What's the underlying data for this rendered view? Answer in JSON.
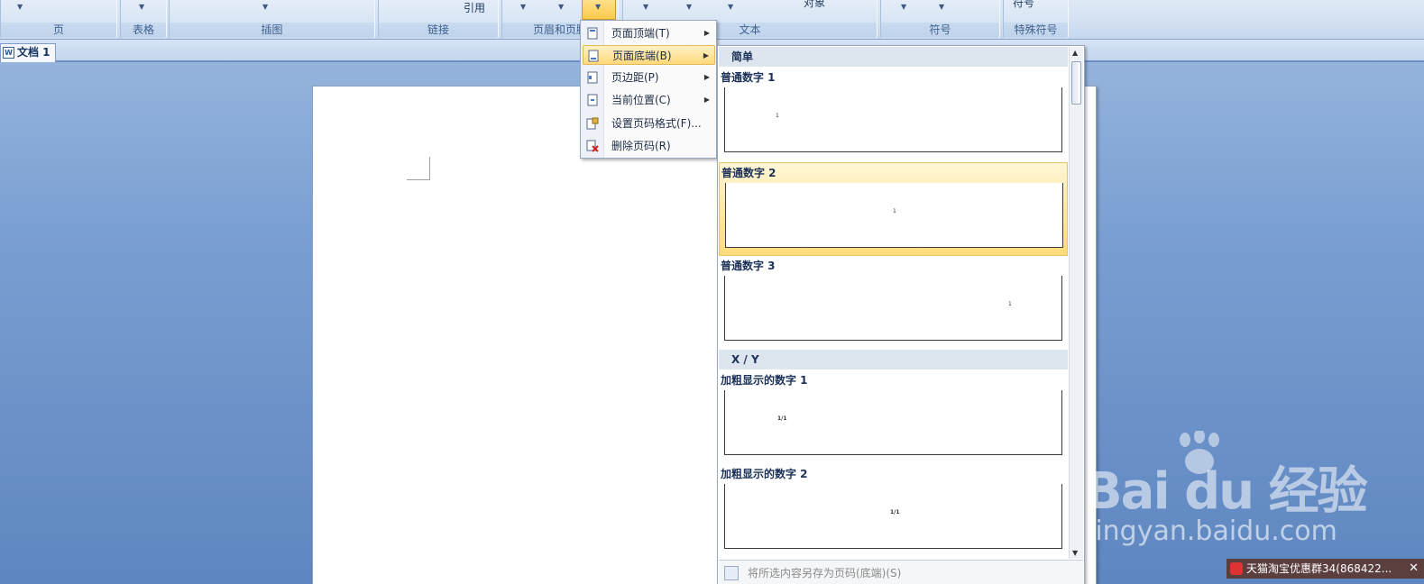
{
  "ribbon": {
    "groups": [
      {
        "label": "页"
      },
      {
        "label": "表格"
      },
      {
        "label": "插图"
      },
      {
        "label": "链接"
      },
      {
        "label": "页眉和页脚"
      },
      {
        "label": "文本"
      },
      {
        "label": "符号"
      },
      {
        "label": "特殊符号"
      }
    ],
    "links_button_label": "引用",
    "text_object_label": "对象",
    "symbol_button_label": "符号"
  },
  "document_tab": {
    "label": "文档 1"
  },
  "page_number_menu": {
    "items": [
      {
        "label": "页面顶端(T)",
        "has_submenu": true,
        "icon": "page-top-icon"
      },
      {
        "label": "页面底端(B)",
        "has_submenu": true,
        "icon": "page-bottom-icon",
        "active": true
      },
      {
        "label": "页边距(P)",
        "has_submenu": true,
        "icon": "page-margin-icon"
      },
      {
        "label": "当前位置(C)",
        "has_submenu": true,
        "icon": "current-position-icon"
      },
      {
        "label": "设置页码格式(F)...",
        "has_submenu": false,
        "icon": "format-page-number-icon"
      },
      {
        "label": "删除页码(R)",
        "has_submenu": false,
        "icon": "delete-page-number-icon"
      }
    ]
  },
  "gallery": {
    "sections": [
      {
        "header": "简单"
      },
      {
        "header": "X / Y"
      }
    ],
    "items": [
      {
        "title": "普通数字 1",
        "sample": "1",
        "align": "left"
      },
      {
        "title": "普通数字 2",
        "sample": "1",
        "align": "center",
        "hovered": true
      },
      {
        "title": "普通数字 3",
        "sample": "1",
        "align": "right"
      },
      {
        "title": "加粗显示的数字 1",
        "sample": "1/1",
        "align": "left"
      },
      {
        "title": "加粗显示的数字 2",
        "sample": "1/1",
        "align": "center"
      }
    ],
    "footer": "将所选内容另存为页码(底端)(S)"
  },
  "watermark": {
    "logo": "Bai du 经验",
    "url": "jingyan.baidu.com"
  },
  "notification": {
    "text": "天猫淘宝优惠群34(868422...",
    "close": "✕"
  },
  "colors": {
    "ribbon_bg": "#d2e0f1",
    "workspace_bg": "#7a9fd2",
    "menu_highlight": "#ffd97a",
    "gallery_header": "#dde5ef"
  }
}
